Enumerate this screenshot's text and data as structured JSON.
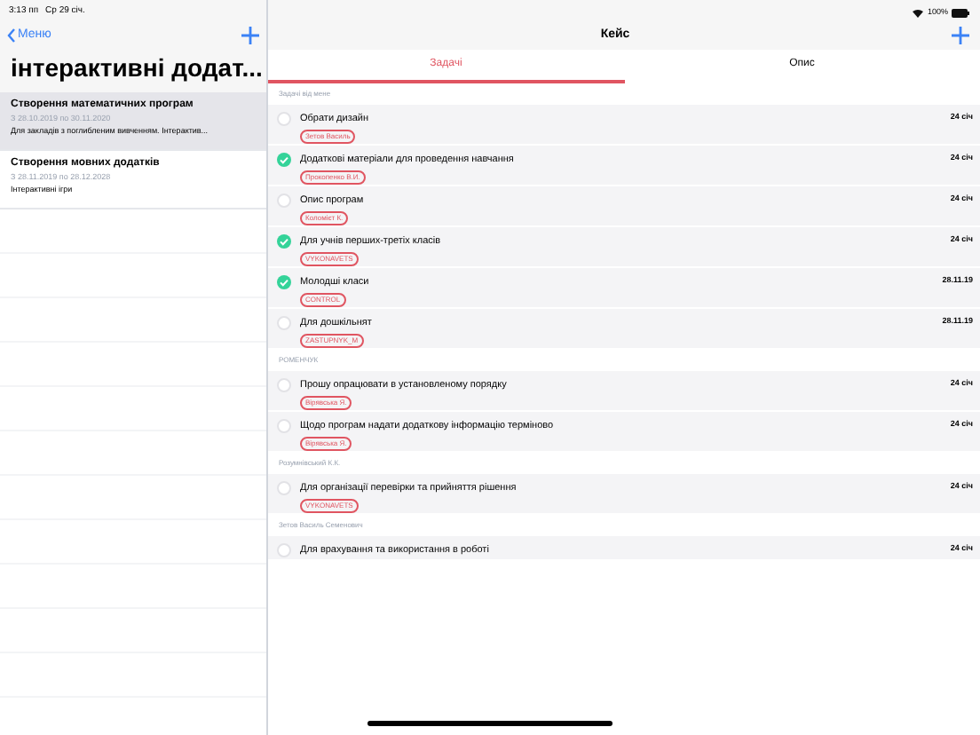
{
  "status_bar": {
    "time": "3:13 пп",
    "date": "Ср 29 січ.",
    "battery": "100%"
  },
  "sidebar": {
    "back": "Меню",
    "title": "інтерактивні додат...",
    "items": [
      {
        "title": "Створення математичних програм",
        "dates": "З 28.10.2019 по 30.11.2020",
        "note": "Для закладів з поглибленим вивченням. Інтерактив...",
        "selected": true
      },
      {
        "title": "Створення мовних додатків",
        "dates": "З 28.11.2019 по 28.12.2028",
        "note": "Інтерактивні ігри",
        "selected": false
      }
    ]
  },
  "detail": {
    "title": "Кейс",
    "tabs": [
      {
        "label": "Задачі",
        "selected": true
      },
      {
        "label": "Опис",
        "selected": false
      }
    ],
    "sections": [
      {
        "header": "Задачі від мене",
        "tasks": [
          {
            "title": "Обрати дизайн",
            "tag": "Зетов Василь",
            "date": "24 січ",
            "checked": false
          },
          {
            "title": "Додаткові матеріали для проведення навчання",
            "tag": "Прокопенко В.И.",
            "date": "24 січ",
            "checked": true
          },
          {
            "title": "Опис програм",
            "tag": "Коломієт К.",
            "date": "24 січ",
            "checked": false
          },
          {
            "title": "Для учнів перших-третіх класів",
            "tag": "VYKONAVETS",
            "date": "24 січ",
            "checked": true
          },
          {
            "title": "Молодші класи",
            "tag": "CONTROL",
            "date": "28.11.19",
            "checked": true
          },
          {
            "title": "Для дошкільнят",
            "tag": "ZASTUPNYK_M",
            "date": "28.11.19",
            "checked": false
          }
        ]
      },
      {
        "header": "РОМЕНЧУК",
        "tasks": [
          {
            "title": "Прошу опрацювати в установленому порядку",
            "tag": "Вірявська Я.",
            "date": "24 січ",
            "checked": false
          },
          {
            "title": "Щодо програм надати додаткову інформацію терміново",
            "tag": "Вірявська Я.",
            "date": "24 січ",
            "checked": false
          }
        ]
      },
      {
        "header": "Розумнівський К.К.",
        "tasks": [
          {
            "title": "Для організації перевірки та прийняття рішення",
            "tag": "VYKONAVETS",
            "date": "24 січ",
            "checked": false
          }
        ]
      },
      {
        "header": "Зетов Василь Семенович",
        "tasks": [
          {
            "title": "Для врахування та використання в роботі",
            "date": "24 січ",
            "checked": false
          }
        ]
      }
    ]
  }
}
